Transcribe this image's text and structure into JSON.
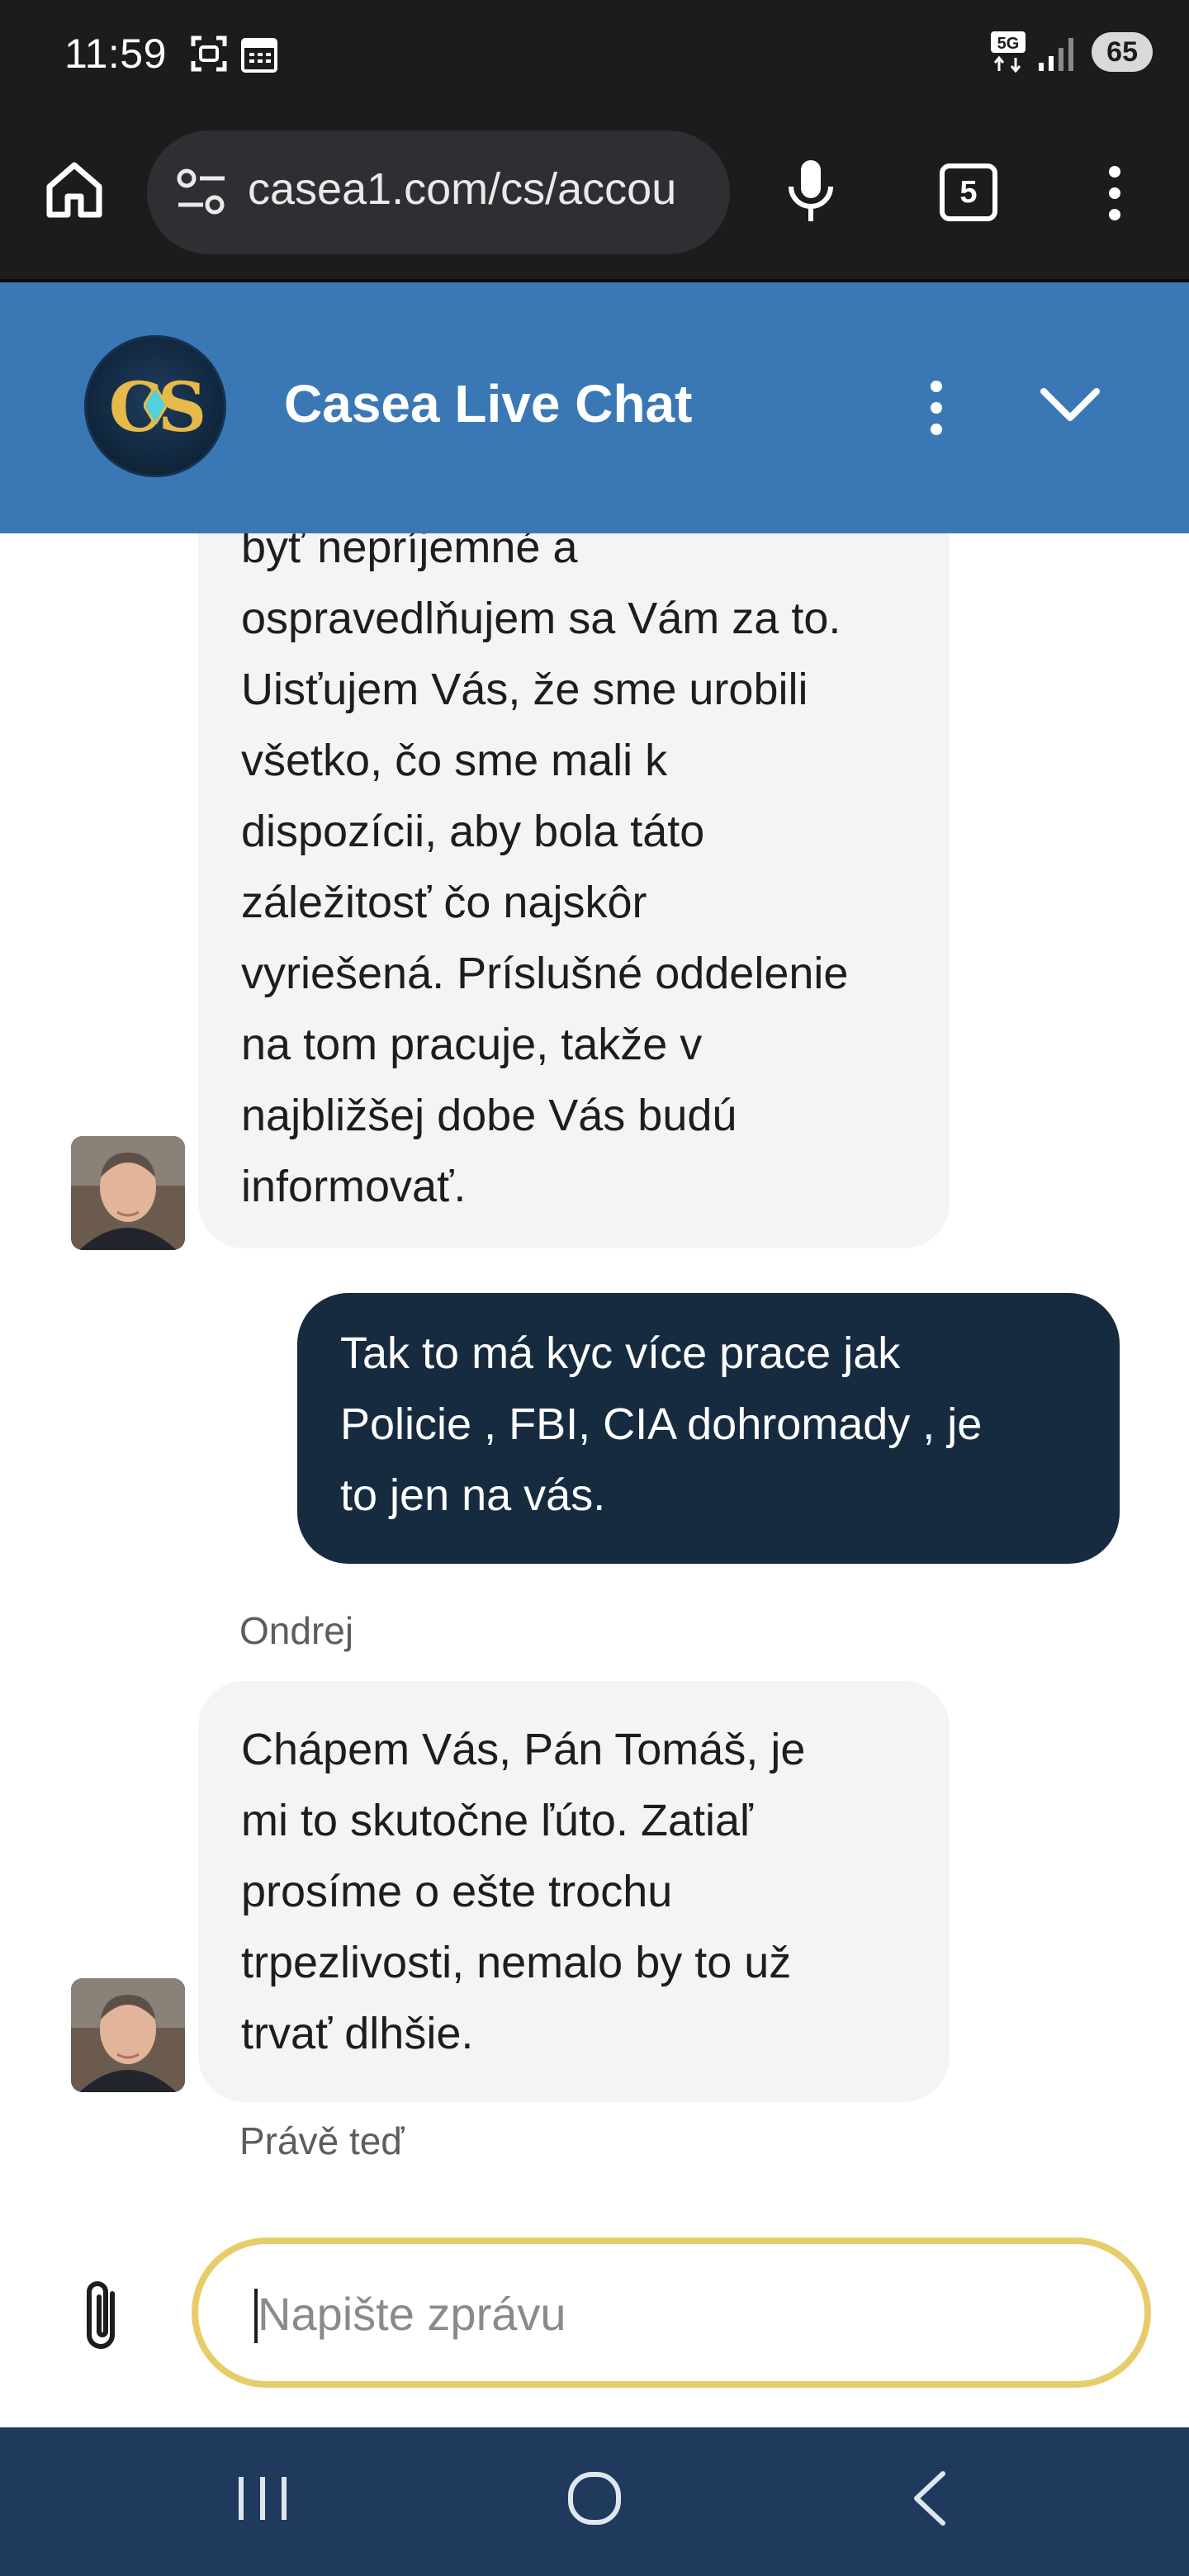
{
  "status_bar": {
    "time": "11:59",
    "network": "5G",
    "battery": "65",
    "icons": [
      "screenshot-icon",
      "calendar-icon",
      "signal-icon"
    ]
  },
  "browser": {
    "url": "casea1.com/cs/accou",
    "tab_count": "5",
    "icons": [
      "home-icon",
      "site-settings-icon",
      "microphone-icon",
      "tabs-icon",
      "more-vert-icon"
    ]
  },
  "chat": {
    "title": "Casea Live Chat",
    "logo_text": "CS",
    "colors": {
      "header": "#3a78b5",
      "user_bubble": "#172b40",
      "agent_bubble": "#f3f4f6",
      "input_border": "#e7cc6a"
    },
    "messages": [
      {
        "from": "agent",
        "lines": [
          "byť nepríjemné a",
          "ospravedlňujem sa Vám za to.",
          "Uisťujem Vás, že sme urobili",
          "všetko, čo sme mali k",
          "dispozícii, aby bola táto",
          "záležitosť čo najskôr",
          "vyriešená. Príslušné oddelenie",
          "na tom pracuje, takže v",
          "najbližšej dobe Vás budú",
          "informovať."
        ]
      },
      {
        "from": "user",
        "lines": [
          "Tak to má kyc více prace jak",
          "Policie , FBI,  CIA dohromady , je",
          "to jen na vás."
        ]
      },
      {
        "from": "agent",
        "sender": "Ondrej",
        "lines": [
          "Chápem Vás, Pán Tomáš, je",
          "mi to skutočne ľúto. Zatiaľ",
          "prosíme o ešte trochu",
          "trpezlivosti, nemalo by to už",
          "trvať dlhšie."
        ],
        "timestamp": "Právě teď"
      }
    ]
  },
  "composer": {
    "placeholder": "Napište zprávu",
    "value": ""
  }
}
